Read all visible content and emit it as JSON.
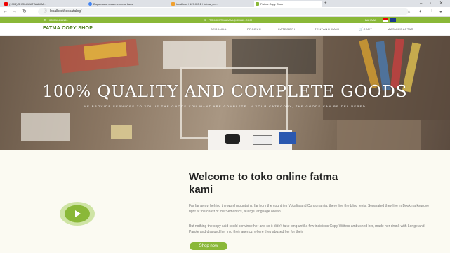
{
  "browser": {
    "tabs": [
      {
        "label": "(1903) SHOLAWAT NABI M..."
      },
      {
        "label": "Bagaimana cara membuat kaos"
      },
      {
        "label": "localhost / 127.0.0.1 / fatma_co..."
      },
      {
        "label": "Fatma Copy Shop"
      }
    ],
    "address": "localhost/tescatalog/"
  },
  "topbar": {
    "phone": "085710445151",
    "email": "TOKOFATMAKAMI@GMAIL.COM",
    "language": "BAHASA"
  },
  "nav": {
    "brand": "FATMA COPY SHOP",
    "items": [
      "BERANDA",
      "PRODUK",
      "KATEGORI",
      "TENTANG KAMI",
      "CART",
      "MASUK/DAFTAR"
    ]
  },
  "hero": {
    "title": "100% QUALITY AND COMPLETE GOODS",
    "subtitle": "WE PROVIDE SERVICES TO YOU IF THE GOODS YOU WANT ARE COMPLETE IN YOUR CATEGORY, THE GOODS CAN BE DELIVERED"
  },
  "welcome": {
    "title": "Welcome to toko online fatma kami",
    "para1": "Far far away, behind the word mountains, far from the countries Vokalia and Consonantia, there live the blind texts. Separated they live in Bookmarksgrove right at the coast of the Semantics, a large language ocean.",
    "para2": "But nothing the copy said could convince her and so it didn't take long until a few insidious Copy Writers ambushed her, made her drunk with Longe and Parole and dragged her into their agency, where they abused her for their.",
    "button": "Shop now"
  },
  "colors": {
    "accent": "#8ab838",
    "brand": "#4a7a1c"
  },
  "icons": [
    "play-icon",
    "phone-icon",
    "mail-icon",
    "cart-icon",
    "flag-icon"
  ]
}
